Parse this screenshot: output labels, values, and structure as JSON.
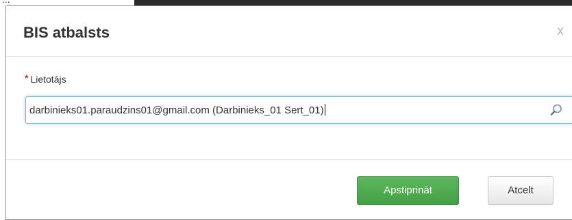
{
  "header": {
    "top_partial_text": "...",
    "title": "BIS atbalsts",
    "close_label": "x"
  },
  "form": {
    "required_mark": "*",
    "user_label": "Lietotājs",
    "user_value": "darbinieks01.paraudzins01@gmail.com (Darbinieks_01 Sert_01)"
  },
  "footer": {
    "confirm_label": "Apstiprināt",
    "cancel_label": "Atcelt"
  },
  "icons": {
    "search": "search-icon",
    "close": "close-icon"
  },
  "colors": {
    "confirm": "#5cb85c",
    "focus_border": "#66afe9",
    "required": "#c9302c"
  }
}
